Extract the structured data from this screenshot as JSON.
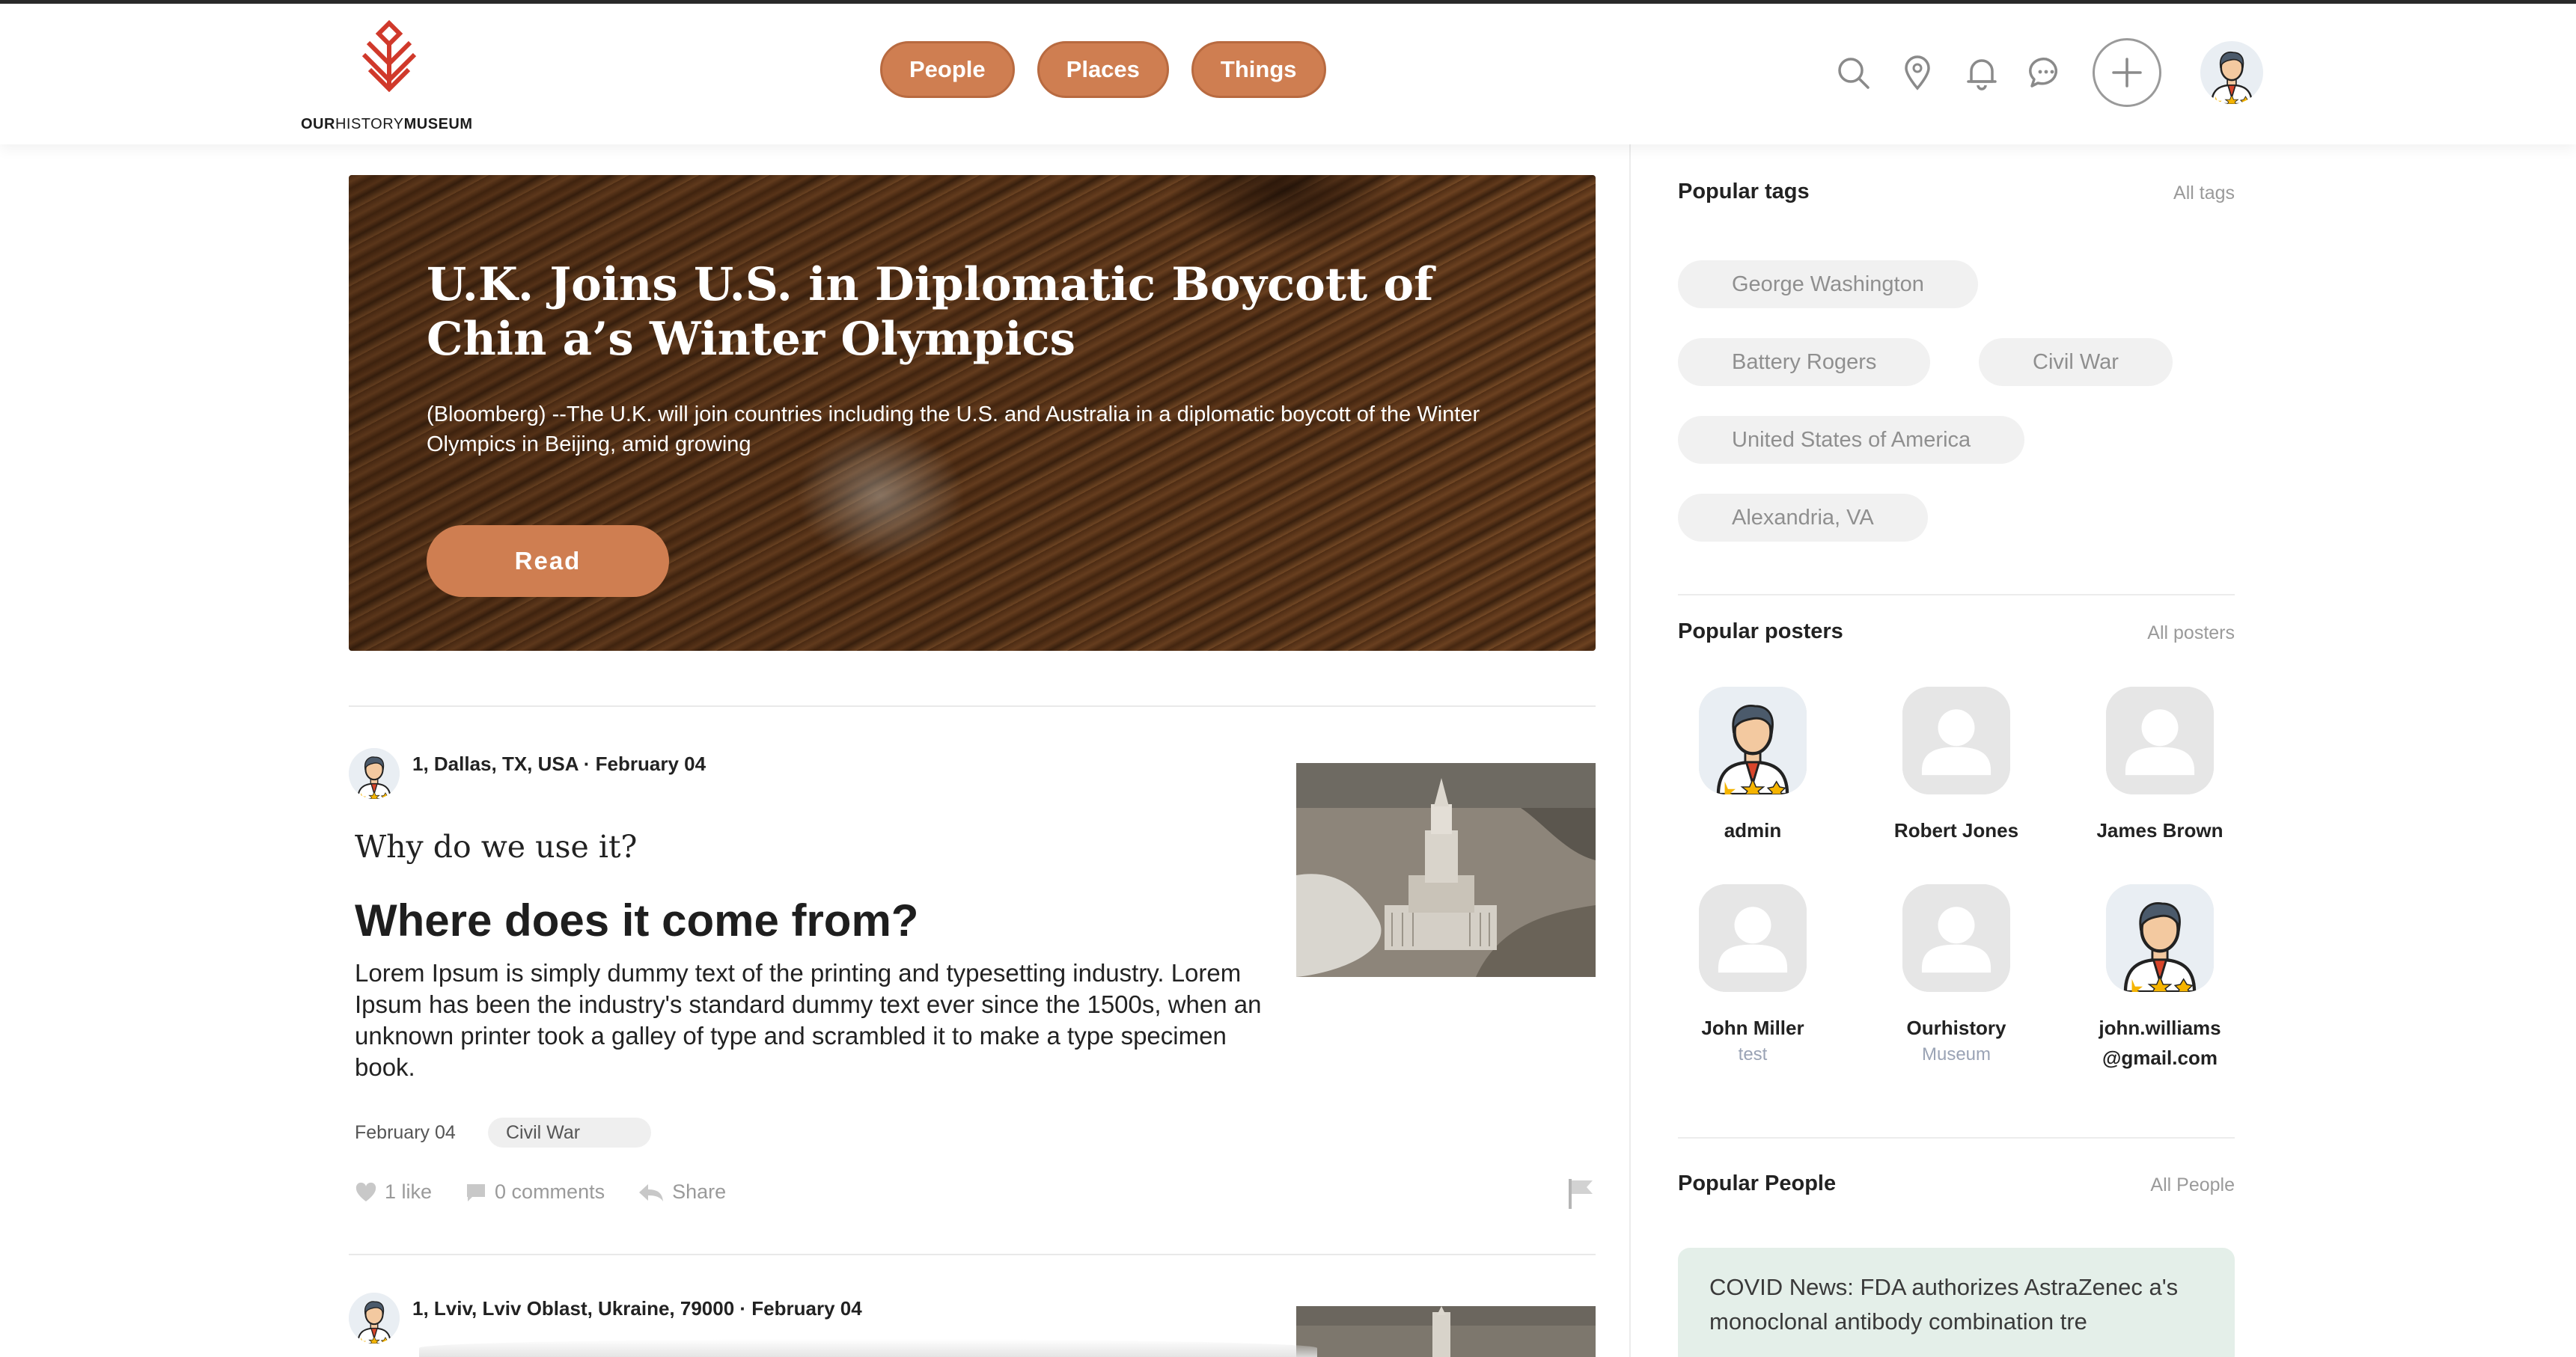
{
  "brand": {
    "logo_part1": "OUR",
    "logo_part2": "HISTORY",
    "logo_part3": "MUSEUM"
  },
  "nav": {
    "people": "People",
    "places": "Places",
    "things": "Things"
  },
  "header_icons": [
    "search-icon",
    "location-pin-icon",
    "bell-icon",
    "chat-icon",
    "plus-icon",
    "user-avatar"
  ],
  "hero": {
    "title": "U.K. Joins U.S. in Diplomatic Boycott of Chin a’s Winter Olympics",
    "description": "(Bloomberg) --The U.K. will join countries including the U.S. and Australia in a diplomatic boycott of the Winter Olympics in Beijing, amid growing",
    "read_label": "Read"
  },
  "posts": [
    {
      "meta": "1, Dallas, TX, USA · February 04",
      "subtitle": "Why do we use it?",
      "title": "Where does it come from?",
      "body": "Lorem Ipsum is simply dummy text of the printing and typesetting industry. Lorem Ipsum has been the industry's standard dummy text ever since the 1500s, when an unknown printer took a galley of type and scrambled it to make a type specimen book.",
      "date": "February 04",
      "tag": "Civil War",
      "likes": "1 like",
      "comments": "0 comments",
      "share": "Share"
    },
    {
      "meta": "1, Lviv, Lviv Oblast, Ukraine, 79000 · February 04"
    }
  ],
  "sidebar": {
    "popular_tags": {
      "heading": "Popular tags",
      "link": "All tags",
      "tags": [
        "George Washington",
        "Battery Rogers",
        "Civil War",
        "United States of America",
        "Alexandria, VA"
      ]
    },
    "popular_posters": {
      "heading": "Popular posters",
      "link": "All posters",
      "posters": [
        {
          "name": "admin",
          "sub": ""
        },
        {
          "name": "Robert Jones",
          "sub": ""
        },
        {
          "name": "James Brown",
          "sub": ""
        },
        {
          "name": "John Miller",
          "sub": "test"
        },
        {
          "name": "Ourhistory",
          "sub": "Museum"
        },
        {
          "name": "john.williams @gmail.com",
          "sub": ""
        }
      ]
    },
    "popular_people": {
      "heading": "Popular People",
      "link": "All People",
      "card_text": "COVID News: FDA authorizes AstraZenec a's monoclonal antibody combination tre"
    }
  },
  "colors": {
    "accent": "#cf7e51",
    "logo_red": "#d0392b",
    "covid_card_bg": "#e4efe9"
  }
}
